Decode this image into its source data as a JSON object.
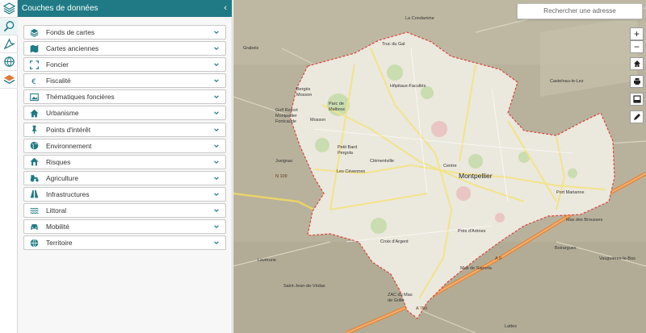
{
  "panel": {
    "title": "Couches de données",
    "collapse_glyph": "‹"
  },
  "rail": [
    {
      "icon": "layers-icon"
    },
    {
      "icon": "search-icon"
    },
    {
      "icon": "draw-icon"
    },
    {
      "icon": "globe-icon"
    },
    {
      "icon": "basemap-icon"
    }
  ],
  "layers": [
    {
      "label": "Fonds de cartes",
      "icon": "layers-icon"
    },
    {
      "label": "Cartes anciennes",
      "icon": "map-icon"
    },
    {
      "label": "Foncier",
      "icon": "boundary-icon"
    },
    {
      "label": "Fiscalité",
      "icon": "euro-icon"
    },
    {
      "label": "Thématiques foncières",
      "icon": "image-icon"
    },
    {
      "label": "Urbanisme",
      "icon": "home-icon"
    },
    {
      "label": "Points d'intérêt",
      "icon": "pin-icon"
    },
    {
      "label": "Environnement",
      "icon": "earth-icon"
    },
    {
      "label": "Risques",
      "icon": "house-risk-icon"
    },
    {
      "label": "Agriculture",
      "icon": "tractor-icon"
    },
    {
      "label": "Infrastructures",
      "icon": "road-icon"
    },
    {
      "label": "Littoral",
      "icon": "waves-icon"
    },
    {
      "label": "Mobilité",
      "icon": "car-icon"
    },
    {
      "label": "Territoire",
      "icon": "globe-icon"
    }
  ],
  "search": {
    "placeholder": "Rechercher une adresse"
  },
  "map_controls": {
    "zoom_in": "+",
    "zoom_out": "−"
  },
  "map_labels": {
    "city": "Montpellier",
    "places": [
      "Truc du Gal",
      "Hôpitaux-Facultés",
      "Parc de Malbosc",
      "Bergès Mosson",
      "Golf Resort Montpellier Fontcaude",
      "Petit Bard Pergola",
      "Clémentville",
      "Centre",
      "Les Cévennes",
      "Port Marianne",
      "Mas des Brousses",
      "Croix d'Argent",
      "Près d'Arènes",
      "Mas de Saporta",
      "Juvignac",
      "Lavérune",
      "Saint-Jean-de-Védas",
      "ZAC du Mas de Grille",
      "Lattes",
      "Castelnau-le-Lez",
      "Boirargues",
      "Vauguières-le-Bas",
      "Grabels",
      "La Condamine",
      "Mosson"
    ],
    "roads": [
      "A 709",
      "A 9",
      "N 109"
    ]
  },
  "colors": {
    "header": "#1f7a85",
    "boundary": "#d9453b",
    "city_fill": "#e9e6dc",
    "map_bg": "#b9b39f"
  }
}
